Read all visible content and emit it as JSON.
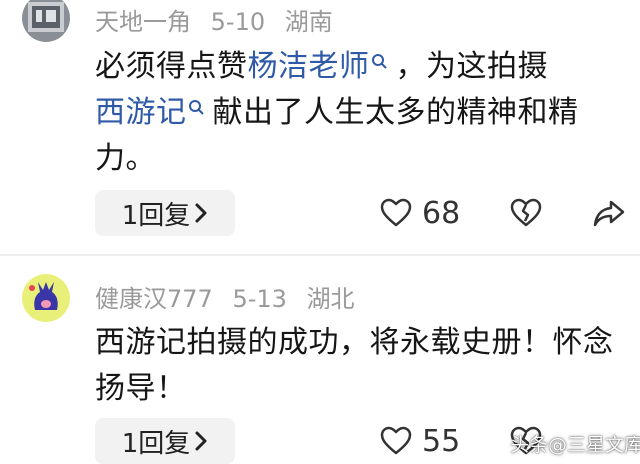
{
  "comments": [
    {
      "username": "天地一角",
      "date": "5-10",
      "location": "湖南",
      "text_part1": "必须得点赞",
      "link1": "杨洁老师",
      "text_part2": "，为这拍摄",
      "link2": "西游记",
      "text_part3": "献出了人生太多的精神和精力。",
      "reply_label": "1回复",
      "likes": "68"
    },
    {
      "username": "健康汉777",
      "date": "5-13",
      "location": "湖北",
      "text": "西游记拍摄的成功，将永载史册！怀念扬导！",
      "reply_label": "1回复",
      "likes": "55"
    }
  ],
  "watermark": "头条@三星文库",
  "colors": {
    "link": "#2f5aa8",
    "meta": "#9a9a9a",
    "reply_bg": "#f2f2f2",
    "avatar2_bg": "#e9f07a",
    "paw": "#3a36a8"
  }
}
